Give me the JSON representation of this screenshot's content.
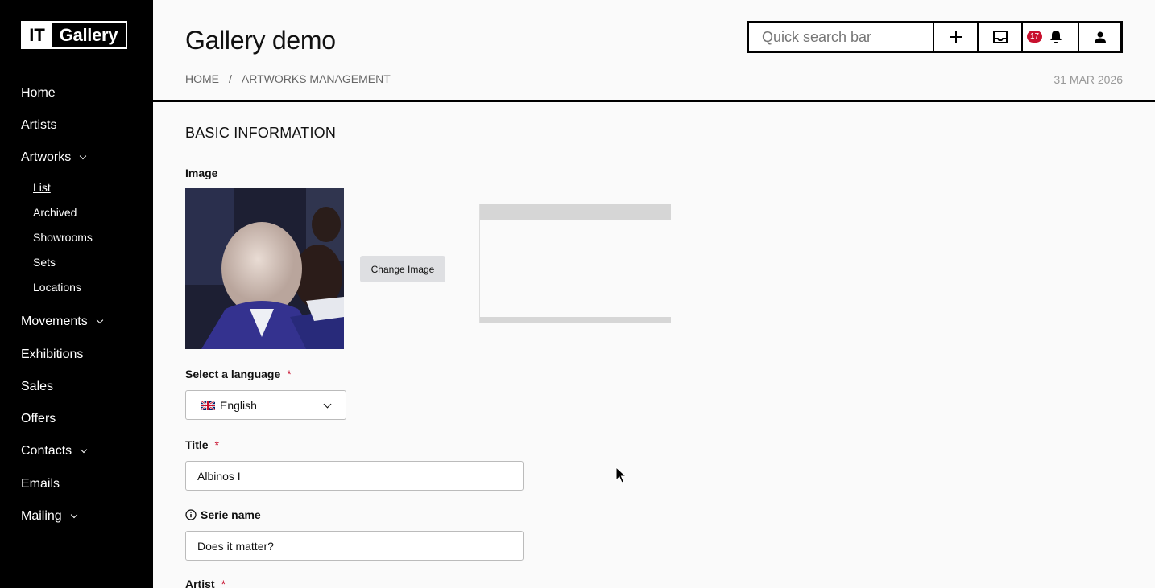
{
  "logo": {
    "it": "IT",
    "gallery": "Gallery"
  },
  "sidebar": {
    "items": [
      {
        "label": "Home"
      },
      {
        "label": "Artists"
      },
      {
        "label": "Artworks"
      },
      {
        "label": "Movements"
      },
      {
        "label": "Exhibitions"
      },
      {
        "label": "Sales"
      },
      {
        "label": "Offers"
      },
      {
        "label": "Contacts"
      },
      {
        "label": "Emails"
      },
      {
        "label": "Mailing"
      }
    ],
    "artworks_sub": [
      {
        "label": "List",
        "active": true
      },
      {
        "label": "Archived"
      },
      {
        "label": "Showrooms"
      },
      {
        "label": "Sets"
      },
      {
        "label": "Locations"
      }
    ]
  },
  "header": {
    "title": "Gallery demo",
    "breadcrumb": [
      "HOME",
      "/",
      "ARTWORKS MANAGEMENT"
    ],
    "date": "31 MAR 2026",
    "search_placeholder": "Quick search bar",
    "notification_count": "17"
  },
  "form": {
    "section_title": "BASIC INFORMATION",
    "image_label": "Image",
    "change_image_label": "Change Image",
    "language_label": "Select a language",
    "language_value": "English",
    "title_label": "Title",
    "title_value": "Albinos I",
    "serie_label": "Serie name",
    "serie_value": "Does it matter?",
    "artist_label": "Artist",
    "required_mark": "*"
  },
  "colors": {
    "sidebar": "#000000",
    "required": "#c8102e",
    "badge": "#c8102e"
  }
}
